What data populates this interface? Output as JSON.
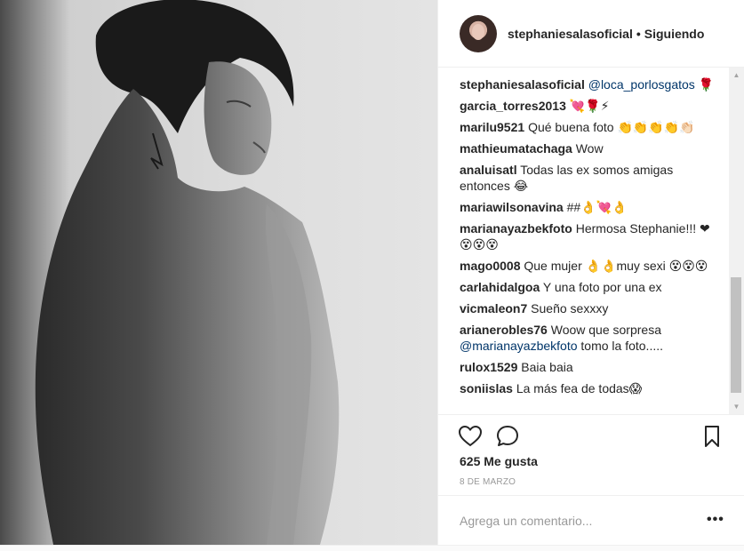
{
  "header": {
    "username": "stephaniesalasoficial",
    "separator": "•",
    "follow_status": "Siguiendo",
    "avatar_icon": "profile-avatar"
  },
  "comments": [
    {
      "user": "stephaniesalasoficial",
      "mention": "@loca_porlosgatos",
      "text": " 🌹"
    },
    {
      "user": "garcia_torres2013",
      "text": "💘🌹⚡"
    },
    {
      "user": "marilu9521",
      "text": "Qué buena foto 👏👏👏👏👏🏻"
    },
    {
      "user": "mathieumatachaga",
      "text": "Wow"
    },
    {
      "user": "analuisatl",
      "text": "Todas las ex somos amigas entonces 😂"
    },
    {
      "user": "mariawilsonavina",
      "text": "##👌💘👌"
    },
    {
      "user": "marianayazbekfoto",
      "text": "Hermosa Stephanie!!! ❤😵😵😵"
    },
    {
      "user": "mago0008",
      "text": "Que mujer 👌👌muy sexi 😵😵😵"
    },
    {
      "user": "carlahidalgoa",
      "text": "Y una foto por una ex"
    },
    {
      "user": "vicmaleon7",
      "text": "Sueño sexxxy"
    },
    {
      "user": "arianerobles76",
      "text": "Woow que sorpresa ",
      "mention": "@marianayazbekfoto",
      "text_after": " tomo la foto....."
    },
    {
      "user": "rulox1529",
      "text": "Baia baia"
    },
    {
      "user": "soniislas",
      "text": "La más fea de todas😱"
    }
  ],
  "actions": {
    "like_icon": "heart-outline",
    "comment_icon": "speech-bubble",
    "save_icon": "bookmark-outline"
  },
  "likes": "625 Me gusta",
  "date": "8 DE MARZO",
  "comment_placeholder": "Agrega un comentario...",
  "more_label": "•••",
  "scrollbar": {
    "up": "▲",
    "down": "▼"
  }
}
